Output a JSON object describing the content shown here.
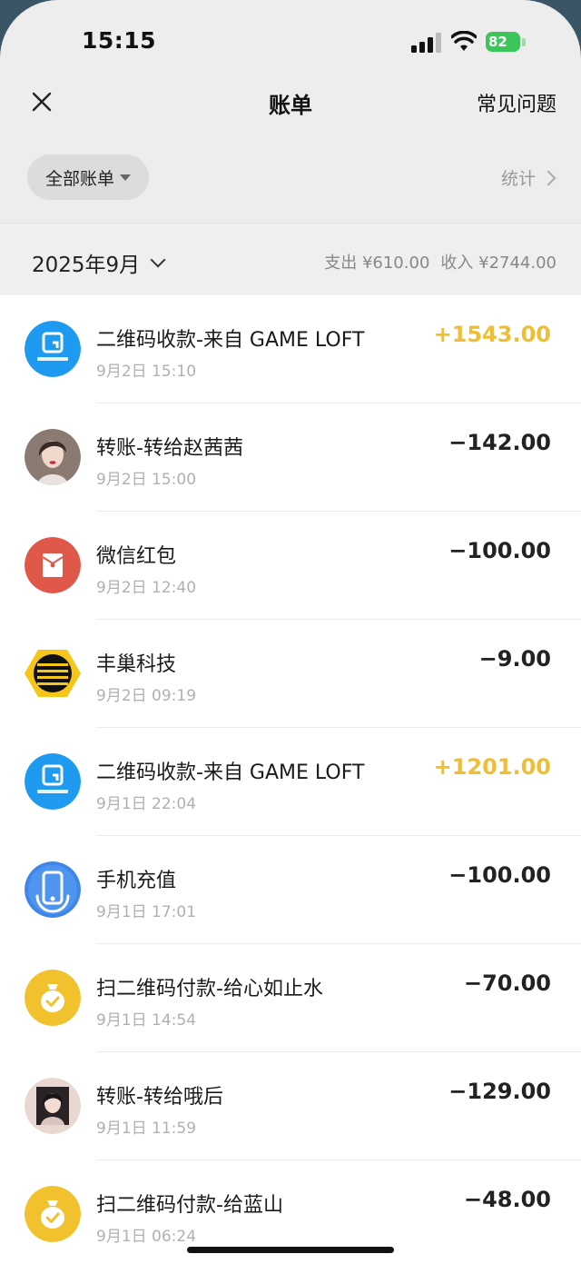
{
  "status_bar": {
    "time": "15:15",
    "battery": "82"
  },
  "nav": {
    "title": "账单",
    "faq": "常见问题"
  },
  "filter": {
    "label": "全部账单",
    "stats": "统计"
  },
  "month": {
    "label": "2025年9月",
    "expense": "支出 ¥610.00",
    "income": "收入 ¥2744.00"
  },
  "transactions": [
    {
      "title": "二维码收款-来自 GAME LOFT",
      "time": "9月2日 15:10",
      "amount": "+1543.00",
      "type": "income",
      "icon": "gameloft-logo"
    },
    {
      "title": "转账-转给赵茜茜",
      "time": "9月2日 15:00",
      "amount": "−142.00",
      "type": "expense",
      "icon": "user-avatar"
    },
    {
      "title": "微信红包",
      "time": "9月2日 12:40",
      "amount": "−100.00",
      "type": "expense",
      "icon": "red-packet-icon"
    },
    {
      "title": "丰巢科技",
      "time": "9月2日 09:19",
      "amount": "−9.00",
      "type": "expense",
      "icon": "hive-box-logo"
    },
    {
      "title": "二维码收款-来自 GAME LOFT",
      "time": "9月1日 22:04",
      "amount": "+1201.00",
      "type": "income",
      "icon": "gameloft-logo"
    },
    {
      "title": "手机充值",
      "time": "9月1日 17:01",
      "amount": "−100.00",
      "type": "expense",
      "icon": "mobile-recharge-icon"
    },
    {
      "title": "扫二维码付款-给心如止水",
      "time": "9月1日 14:54",
      "amount": "−70.00",
      "type": "expense",
      "icon": "money-bag-icon"
    },
    {
      "title": "转账-转给哦后",
      "time": "9月1日 11:59",
      "amount": "−129.00",
      "type": "expense",
      "icon": "user-avatar"
    },
    {
      "title": "扫二维码付款-给蓝山",
      "time": "9月1日 06:24",
      "amount": "−48.00",
      "type": "expense",
      "icon": "money-bag-icon"
    }
  ],
  "colors": {
    "income": "#f0be35",
    "expense": "#222222",
    "gameloft": "#1e9bf0",
    "red_packet": "#e0584a",
    "money_bag": "#f2c12e",
    "hive_box": "#f5c518"
  }
}
